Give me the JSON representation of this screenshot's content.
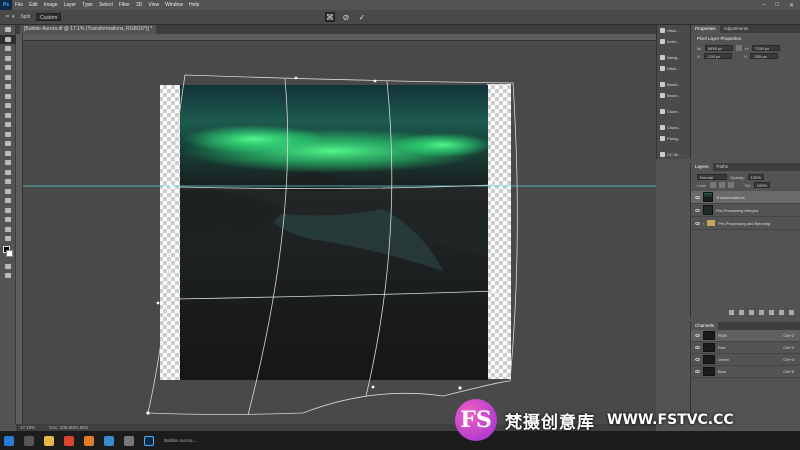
{
  "app": {
    "logo": "Ps"
  },
  "menubar": {
    "items": [
      "File",
      "Edit",
      "Image",
      "Layer",
      "Type",
      "Select",
      "Filter",
      "3D",
      "View",
      "Window",
      "Help"
    ]
  },
  "options": {
    "tool_label": "Split",
    "mode_label": "Custom"
  },
  "document": {
    "tab_title": "[Bubble Aurora.tif @ 17.1% (Transformations, RGB/16*)] *"
  },
  "status": {
    "zoom": "17.19%",
    "doc_size": "Doc: 206.9M/1.98G"
  },
  "properties": {
    "tabs": [
      "Properties",
      "Adjustments"
    ],
    "title": "Pixel Layer Properties",
    "w": "6638 px",
    "h": "7159 px",
    "x": "-130 px",
    "y": "-255 px",
    "link_label": "GO"
  },
  "iconstrip": {
    "items": [
      "Histo...",
      "Actio...",
      "Navig...",
      "Histo...",
      "Brush...",
      "Brush...",
      "Clone...",
      "Chara...",
      "Parag...",
      "CC lib..."
    ]
  },
  "layers": {
    "tabs": [
      "Layers",
      "Paths"
    ],
    "blend_mode": "Normal",
    "opacity_label": "Opacity:",
    "opacity": "100%",
    "lock_label": "Lock:",
    "fill_label": "Fill:",
    "fill": "100%",
    "items": [
      {
        "name": "Transformations",
        "thumb": "aurora",
        "selected": true
      },
      {
        "name": "Pre-Processing Merged",
        "thumb": "dark",
        "selected": false
      },
      {
        "name": "Pre-Processing and Blending",
        "thumb": "folder",
        "selected": false
      }
    ]
  },
  "channels": {
    "title": "Channels",
    "items": [
      {
        "name": "RGB",
        "shortcut": "Ctrl+2"
      },
      {
        "name": "Red",
        "shortcut": "Ctrl+3"
      },
      {
        "name": "Green",
        "shortcut": "Ctrl+4"
      },
      {
        "name": "Blue",
        "shortcut": "Ctrl+5"
      }
    ]
  },
  "taskbar": {
    "items": [
      "start",
      "search",
      "explorer",
      "chrome",
      "firefox",
      "mail",
      "app",
      "photoshop"
    ],
    "running_label": "Bubble Aurora..."
  },
  "watermark": {
    "logo": "FS",
    "cn_text": "梵摄创意库",
    "url": "WWW.FSTVC.CC"
  },
  "colors": {
    "aurora": "#2fe07a",
    "guide": "#55d6d6",
    "accent": "#4ab0ff"
  }
}
